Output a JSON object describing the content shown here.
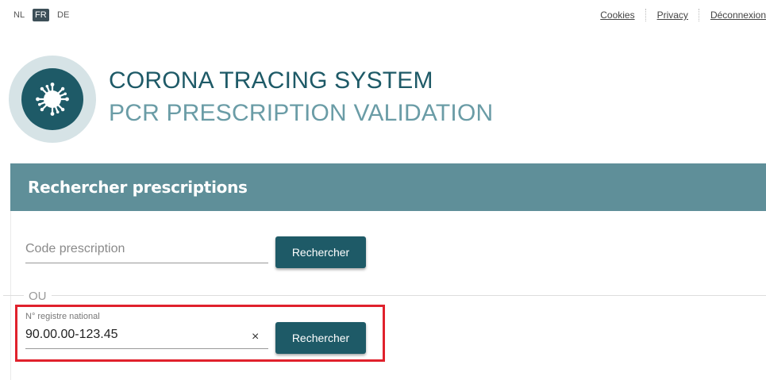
{
  "languages": [
    "NL",
    "FR",
    "DE"
  ],
  "active_language": "FR",
  "top_links": {
    "cookies": "Cookies",
    "privacy": "Privacy",
    "logout": "Déconnexion"
  },
  "brand": {
    "title": "CORONA TRACING SYSTEM",
    "subtitle": "PCR PRESCRIPTION VALIDATION",
    "logo_icon": "virus-icon",
    "primary_color": "#1e5a67",
    "secondary_color": "#6a9ca6"
  },
  "search_panel": {
    "title": "Rechercher prescriptions",
    "header_color": "#5f8f99",
    "prescription_code": {
      "placeholder": "Code prescription",
      "value": ""
    },
    "prescription_button": "Rechercher",
    "separator": "OU",
    "national_register": {
      "label": "N° registre national",
      "value": "90.00.00-123.45",
      "clear_icon": "×"
    },
    "national_register_button": "Rechercher",
    "highlight_color": "#e0212c"
  }
}
